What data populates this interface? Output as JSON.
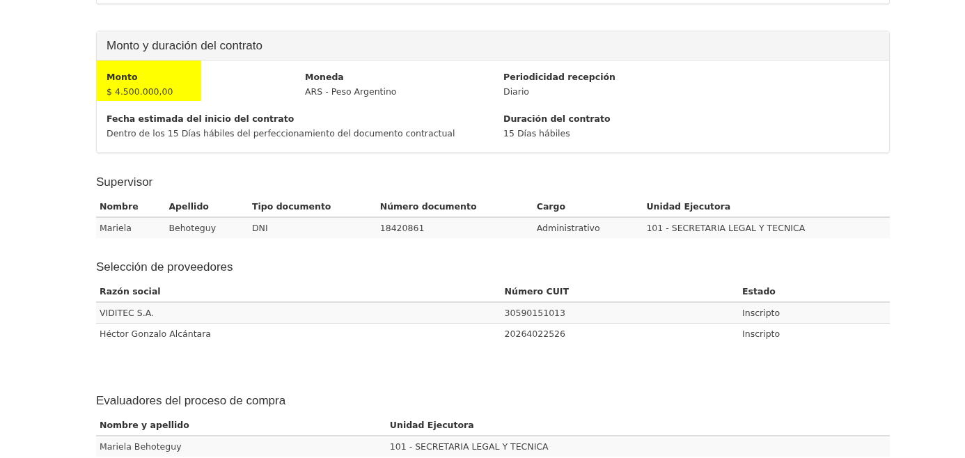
{
  "contract_card": {
    "title": "Monto y duración del contrato",
    "fields": [
      {
        "label": "Monto",
        "value": "$ 4.500.000,00",
        "highlighted": true
      },
      {
        "label": "Moneda",
        "value": "ARS - Peso Argentino",
        "highlighted": false
      },
      {
        "label": "Periodicidad recepción",
        "value": "Diario",
        "highlighted": false
      },
      {
        "label": "Fecha estimada del inicio del contrato",
        "value": "Dentro de los 15 Días hábiles del perfeccionamiento del documento contractual",
        "highlighted": false
      },
      {
        "label": "Duración del contrato",
        "value": "15 Días hábiles",
        "highlighted": false
      }
    ]
  },
  "sections": [
    {
      "title": "Supervisor",
      "columns": [
        "Nombre",
        "Apellido",
        "Tipo documento",
        "Número documento",
        "Cargo",
        "Unidad Ejecutora"
      ],
      "rows": [
        [
          "Mariela",
          "Behoteguy",
          "DNI",
          "18420861",
          "Administrativo",
          "101 - SECRETARIA LEGAL Y TECNICA"
        ]
      ]
    },
    {
      "title": "Selección de proveedores",
      "columns": [
        "Razón social",
        "Número CUIT",
        "Estado"
      ],
      "rows": [
        [
          "VIDITEC S.A.",
          "30590151013",
          "Inscripto"
        ],
        [
          "Héctor Gonzalo Alcántara",
          "20264022526",
          "Inscripto"
        ]
      ]
    },
    {
      "title": "Evaluadores del proceso de compra",
      "columns": [
        "Nombre y apellido",
        "Unidad Ejecutora"
      ],
      "rows": [
        [
          "Mariela Behoteguy",
          "101 - SECRETARIA LEGAL Y TECNICA"
        ]
      ]
    }
  ]
}
